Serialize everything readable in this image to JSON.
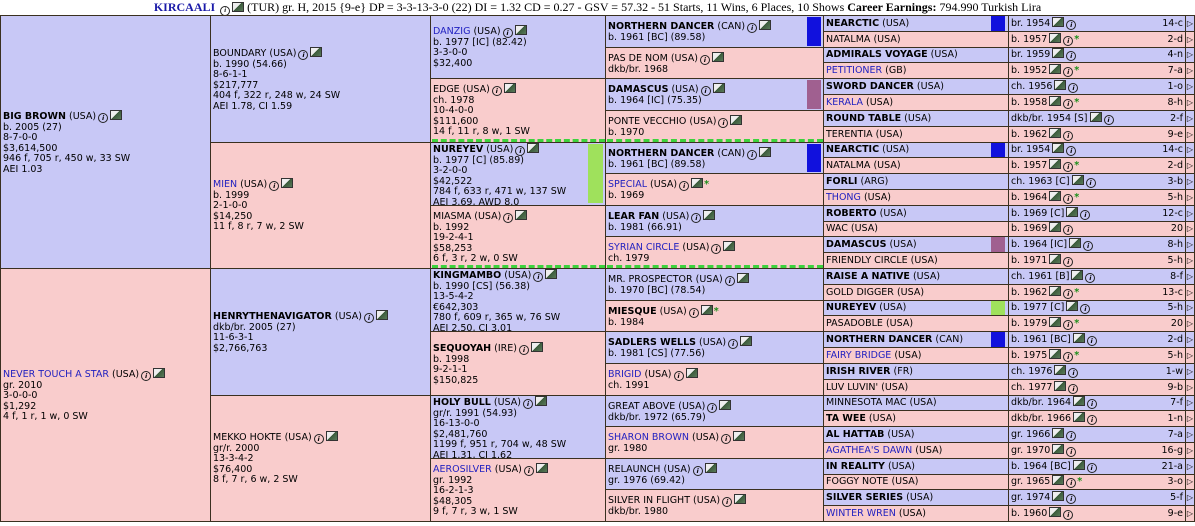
{
  "header": {
    "name": "KIRCAALI",
    "details": "(TUR) gr. H, 2015 {9-e} DP = 3-3-13-3-0 (22) DI = 1.32   CD = 0.27 - GSV = 57.32 - 51 Starts, 11 Wins, 6 Places, 10 Shows",
    "earnings_label": "Career Earnings:",
    "earnings_value": "794.990 Turkish Lira"
  },
  "g1": [
    {
      "name": "BIG BROWN",
      "country": "(USA)",
      "bold": true,
      "link": false,
      "lines": [
        "b. 2005 (27)",
        "8-7-0-0",
        "$3,614,500",
        "946 f, 705 r, 450 w, 33 SW",
        "AEI 1.03"
      ]
    },
    {
      "name": "NEVER TOUCH A STAR",
      "country": "(USA)",
      "bold": false,
      "link": true,
      "lines": [
        "gr. 2010",
        "3-0-0-0",
        "$1,292",
        "4 f, 1 r, 1 w, 0 SW"
      ]
    }
  ],
  "g2": [
    {
      "name": "BOUNDARY",
      "country": "(USA)",
      "bold": false,
      "link": false,
      "lines": [
        "b. 1990 (54.66)",
        "8-6-1-1",
        "$217,777",
        "404 f, 322 r, 248 w, 24 SW",
        "AEI 1.78, CI 1.59"
      ]
    },
    {
      "name": "MIEN",
      "country": "(USA)",
      "bold": false,
      "link": true,
      "lines": [
        "b. 1999",
        "2-1-0-0",
        "$14,250",
        "11 f, 8 r, 7 w, 2 SW"
      ]
    },
    {
      "name": "HENRYTHENAVIGATOR",
      "country": "(USA)",
      "bold": true,
      "link": false,
      "lines": [
        "dkb/br. 2005 (27)",
        "11-6-3-1",
        "$2,766,763"
      ]
    },
    {
      "name": "MEKKO HOKTE",
      "country": "(USA)",
      "bold": false,
      "link": false,
      "lines": [
        "gr/r. 2000",
        "13-3-4-2",
        "$76,400",
        "8 f, 7 r, 6 w, 2 SW"
      ]
    }
  ],
  "g3": [
    {
      "name": "DANZIG",
      "country": "(USA)",
      "bold": false,
      "link": true,
      "lines": [
        "b. 1977 [IC] (82.42)",
        "3-3-0-0",
        "$32,400"
      ]
    },
    {
      "name": "EDGE",
      "country": "(USA)",
      "bold": false,
      "link": false,
      "lines": [
        "ch. 1978",
        "10-4-0-0",
        "$111,600",
        "14 f, 11 r, 8 w, 1 SW"
      ]
    },
    {
      "name": "NUREYEV",
      "country": "(USA)",
      "bold": true,
      "link": false,
      "lines": [
        "b. 1977 [C] (85.89)",
        "3-2-0-0",
        "$42,522",
        "784 f, 633 r, 471 w, 137 SW",
        "AEI 3.69, AWD 8.0"
      ]
    },
    {
      "name": "MIASMA",
      "country": "(USA)",
      "bold": false,
      "link": false,
      "lines": [
        "b. 1992",
        "19-2-4-1",
        "$58,253",
        "6 f, 3 r, 2 w, 0 SW"
      ]
    },
    {
      "name": "KINGMAMBO",
      "country": "(USA)",
      "bold": true,
      "link": false,
      "lines": [
        "b. 1990 [CS] (56.38)",
        "13-5-4-2",
        "€642,303",
        "780 f, 609 r, 365 w, 76 SW",
        "AEI 2.50, CI 3.01"
      ]
    },
    {
      "name": "SEQUOYAH",
      "country": "(IRE)",
      "bold": true,
      "link": false,
      "lines": [
        "b. 1998",
        "9-2-1-1",
        "$150,825"
      ]
    },
    {
      "name": "HOLY BULL",
      "country": "(USA)",
      "bold": true,
      "link": false,
      "lines": [
        "gr/r. 1991 (54.93)",
        "16-13-0-0",
        "$2,481,760",
        "1199 f, 951 r, 704 w, 48 SW",
        "AEI 1.31, CI 1.62"
      ]
    },
    {
      "name": "AEROSILVER",
      "country": "(USA)",
      "bold": false,
      "link": true,
      "lines": [
        "gr. 1992",
        "16-2-1-3",
        "$48,305",
        "9 f, 7 r, 3 w, 1 SW"
      ]
    }
  ],
  "g4": [
    {
      "name": "NORTHERN DANCER",
      "country": "(CAN)",
      "bold": true,
      "link": false,
      "lines": [
        "b. 1961 [BC] (89.58)"
      ],
      "star": false
    },
    {
      "name": "PAS DE NOM",
      "country": "(USA)",
      "bold": false,
      "link": false,
      "lines": [
        "dkb/br. 1968"
      ],
      "star": false
    },
    {
      "name": "DAMASCUS",
      "country": "(USA)",
      "bold": true,
      "link": false,
      "lines": [
        "b. 1964 [IC] (75.35)"
      ],
      "star": false
    },
    {
      "name": "PONTE VECCHIO",
      "country": "(USA)",
      "bold": false,
      "link": false,
      "lines": [
        "b. 1970"
      ],
      "star": false
    },
    {
      "name": "NORTHERN DANCER",
      "country": "(CAN)",
      "bold": true,
      "link": false,
      "lines": [
        "b. 1961 [BC] (89.58)"
      ],
      "star": false
    },
    {
      "name": "SPECIAL",
      "country": "(USA)",
      "bold": false,
      "link": true,
      "lines": [
        "b. 1969"
      ],
      "star": true
    },
    {
      "name": "LEAR FAN",
      "country": "(USA)",
      "bold": true,
      "link": false,
      "lines": [
        "b. 1981 (66.91)"
      ],
      "star": false
    },
    {
      "name": "SYRIAN CIRCLE",
      "country": "(USA)",
      "bold": false,
      "link": true,
      "lines": [
        "ch. 1979"
      ],
      "star": false
    },
    {
      "name": "MR. PROSPECTOR",
      "country": "(USA)",
      "bold": false,
      "link": false,
      "lines": [
        "b. 1970 [BC] (78.54)"
      ],
      "star": false
    },
    {
      "name": "MIESQUE",
      "country": "(USA)",
      "bold": true,
      "link": false,
      "lines": [
        "b. 1984"
      ],
      "star": true
    },
    {
      "name": "SADLERS WELLS",
      "country": "(USA)",
      "bold": true,
      "link": false,
      "lines": [
        "b. 1981 [CS] (77.56)"
      ],
      "star": false
    },
    {
      "name": "BRIGID",
      "country": "(USA)",
      "bold": false,
      "link": true,
      "lines": [
        "ch. 1991"
      ],
      "star": false
    },
    {
      "name": "GREAT ABOVE",
      "country": "(USA)",
      "bold": false,
      "link": false,
      "lines": [
        "dkb/br. 1972 (65.79)"
      ],
      "star": false
    },
    {
      "name": "SHARON BROWN",
      "country": "(USA)",
      "bold": false,
      "link": true,
      "lines": [
        "gr. 1980"
      ],
      "star": false
    },
    {
      "name": "RELAUNCH",
      "country": "(USA)",
      "bold": false,
      "link": false,
      "lines": [
        "gr. 1976 (69.42)"
      ],
      "star": false
    },
    {
      "name": "SILVER IN FLIGHT",
      "country": "(USA)",
      "bold": false,
      "link": false,
      "lines": [
        "dkb/br. 1980"
      ],
      "star": false
    }
  ],
  "g5": [
    {
      "name": "NEARCTIC",
      "country": "(USA)",
      "bold": true,
      "link": false,
      "info": "br. 1954",
      "star": false,
      "dp": "14-c"
    },
    {
      "name": "NATALMA",
      "country": "(USA)",
      "bold": false,
      "link": false,
      "info": "b. 1957",
      "star": true,
      "dp": "2-d"
    },
    {
      "name": "ADMIRALS VOYAGE",
      "country": "(USA)",
      "bold": true,
      "link": false,
      "info": "br. 1959",
      "star": false,
      "dp": "4-n"
    },
    {
      "name": "PETITIONER",
      "country": "(GB)",
      "bold": false,
      "link": true,
      "info": "b. 1952",
      "star": true,
      "dp": "7-a"
    },
    {
      "name": "SWORD DANCER",
      "country": "(USA)",
      "bold": true,
      "link": false,
      "info": "ch. 1956",
      "star": false,
      "dp": "1-o"
    },
    {
      "name": "KERALA",
      "country": "(USA)",
      "bold": false,
      "link": true,
      "info": "b. 1958",
      "star": true,
      "dp": "8-h"
    },
    {
      "name": "ROUND TABLE",
      "country": "(USA)",
      "bold": true,
      "link": false,
      "info": "dkb/br. 1954 [S]",
      "star": false,
      "dp": "2-f"
    },
    {
      "name": "TERENTIA",
      "country": "(USA)",
      "bold": false,
      "link": false,
      "info": "b. 1962",
      "star": false,
      "dp": "9-e"
    },
    {
      "name": "NEARCTIC",
      "country": "(USA)",
      "bold": true,
      "link": false,
      "info": "br. 1954",
      "star": false,
      "dp": "14-c"
    },
    {
      "name": "NATALMA",
      "country": "(USA)",
      "bold": false,
      "link": false,
      "info": "b. 1957",
      "star": true,
      "dp": "2-d"
    },
    {
      "name": "FORLI",
      "country": "(ARG)",
      "bold": true,
      "link": false,
      "info": "ch. 1963 [C]",
      "star": false,
      "dp": "3-b"
    },
    {
      "name": "THONG",
      "country": "(USA)",
      "bold": false,
      "link": true,
      "info": "b. 1964",
      "star": true,
      "dp": "5-h"
    },
    {
      "name": "ROBERTO",
      "country": "(USA)",
      "bold": true,
      "link": false,
      "info": "b. 1969 [C]",
      "star": false,
      "dp": "12-c"
    },
    {
      "name": "WAC",
      "country": "(USA)",
      "bold": false,
      "link": false,
      "info": "b. 1969",
      "star": false,
      "dp": "20"
    },
    {
      "name": "DAMASCUS",
      "country": "(USA)",
      "bold": true,
      "link": false,
      "info": "b. 1964 [IC]",
      "star": false,
      "dp": "8-h"
    },
    {
      "name": "FRIENDLY CIRCLE",
      "country": "(USA)",
      "bold": false,
      "link": false,
      "info": "b. 1971",
      "star": false,
      "dp": "5-h"
    },
    {
      "name": "RAISE A NATIVE",
      "country": "(USA)",
      "bold": true,
      "link": false,
      "info": "ch. 1961 [B]",
      "star": false,
      "dp": "8-f"
    },
    {
      "name": "GOLD DIGGER",
      "country": "(USA)",
      "bold": false,
      "link": false,
      "info": "b. 1962",
      "star": true,
      "dp": "13-c"
    },
    {
      "name": "NUREYEV",
      "country": "(USA)",
      "bold": true,
      "link": false,
      "info": "b. 1977 [C]",
      "star": false,
      "dp": "5-h"
    },
    {
      "name": "PASADOBLE",
      "country": "(USA)",
      "bold": false,
      "link": false,
      "info": "b. 1979",
      "star": true,
      "dp": "20"
    },
    {
      "name": "NORTHERN DANCER",
      "country": "(CAN)",
      "bold": true,
      "link": false,
      "info": "b. 1961 [BC]",
      "star": false,
      "dp": "2-d"
    },
    {
      "name": "FAIRY BRIDGE",
      "country": "(USA)",
      "bold": false,
      "link": true,
      "info": "b. 1975",
      "star": true,
      "dp": "5-h"
    },
    {
      "name": "IRISH RIVER",
      "country": "(FR)",
      "bold": true,
      "link": false,
      "info": "ch. 1976",
      "star": false,
      "dp": "1-w"
    },
    {
      "name": "LUV LUVIN'",
      "country": "(USA)",
      "bold": false,
      "link": false,
      "info": "ch. 1977",
      "star": false,
      "dp": "9-b"
    },
    {
      "name": "MINNESOTA MAC",
      "country": "(USA)",
      "bold": false,
      "link": false,
      "info": "dkb/br. 1964",
      "star": false,
      "dp": "7-f"
    },
    {
      "name": "TA WEE",
      "country": "(USA)",
      "bold": true,
      "link": false,
      "info": "dkb/br. 1966",
      "star": false,
      "dp": "1-n"
    },
    {
      "name": "AL HATTAB",
      "country": "(USA)",
      "bold": true,
      "link": false,
      "info": "gr. 1966",
      "star": false,
      "dp": "7-a"
    },
    {
      "name": "AGATHEA'S DAWN",
      "country": "(USA)",
      "bold": false,
      "link": true,
      "info": "gr. 1970",
      "star": false,
      "dp": "16-g"
    },
    {
      "name": "IN REALITY",
      "country": "(USA)",
      "bold": true,
      "link": false,
      "info": "b. 1964 [BC]",
      "star": false,
      "dp": "21-a"
    },
    {
      "name": "FOGGY NOTE",
      "country": "(USA)",
      "bold": false,
      "link": false,
      "info": "gr. 1965",
      "star": true,
      "dp": "3-o"
    },
    {
      "name": "SILVER SERIES",
      "country": "(USA)",
      "bold": true,
      "link": false,
      "info": "gr. 1974",
      "star": false,
      "dp": "5-f"
    },
    {
      "name": "WINTER WREN",
      "country": "(USA)",
      "bold": false,
      "link": true,
      "info": "b. 1960",
      "star": false,
      "dp": "9-e"
    }
  ],
  "colors": {
    "male_bg": "#c8c8f6",
    "female_bg": "#f9cccc",
    "link": "#1f1fc0",
    "star": "#1a8f1a",
    "dosage_green": "#3dd23d"
  }
}
